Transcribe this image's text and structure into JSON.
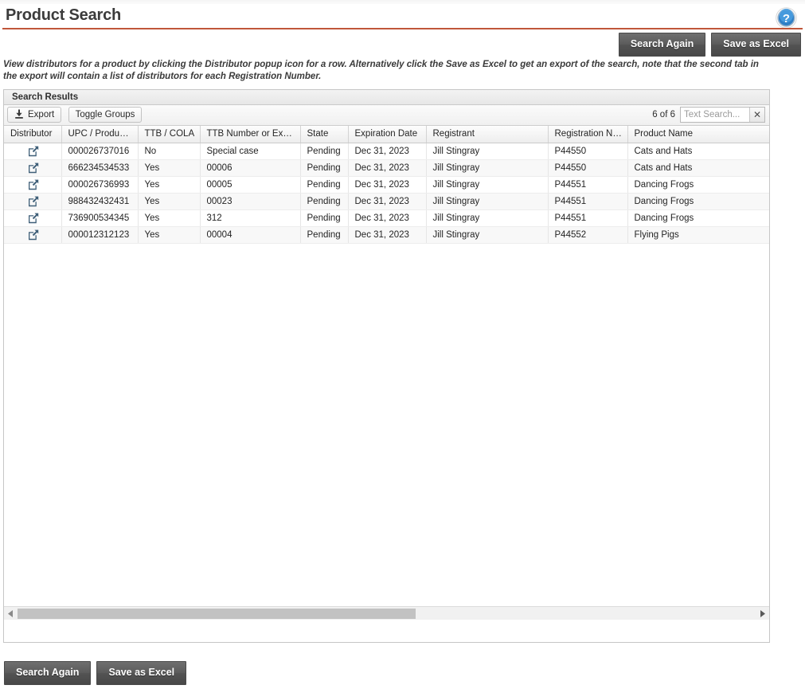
{
  "header": {
    "title": "Product Search",
    "help_icon": "help-circle-icon",
    "accent_color": "#c0563a"
  },
  "top_actions": {
    "search_again_label": "Search Again",
    "save_as_excel_label": "Save as Excel"
  },
  "description": "View distributors for a product by clicking the Distributor popup icon for a row. Alternatively click the Save as Excel to get an export of the search, note that the second tab in the export will contain a list of distributors for each Registration Number.",
  "panel": {
    "header_label": "Search Results"
  },
  "toolbar": {
    "export_label": "Export",
    "export_icon": "download-icon",
    "toggle_groups_label": "Toggle Groups",
    "count_label": "6 of 6",
    "search_placeholder": "Text Search...",
    "search_value": "",
    "clear_icon": "close-icon"
  },
  "grid": {
    "columns": [
      "Distributor",
      "UPC / Product Id",
      "TTB / COLA",
      "TTB Number or Expl...",
      "State",
      "Expiration Date",
      "Registrant",
      "Registration Nu...",
      "Product Name"
    ],
    "row_icon": "external-link-icon",
    "rows": [
      {
        "upc": "000026737016",
        "ttb_cola": "No",
        "ttb_number": "Special case",
        "state": "Pending",
        "expiration": "Dec 31, 2023",
        "registrant": "Jill Stingray",
        "registration": "P44550",
        "product": "Cats and Hats"
      },
      {
        "upc": "666234534533",
        "ttb_cola": "Yes",
        "ttb_number": "00006",
        "state": "Pending",
        "expiration": "Dec 31, 2023",
        "registrant": "Jill Stingray",
        "registration": "P44550",
        "product": "Cats and Hats"
      },
      {
        "upc": "000026736993",
        "ttb_cola": "Yes",
        "ttb_number": "00005",
        "state": "Pending",
        "expiration": "Dec 31, 2023",
        "registrant": "Jill Stingray",
        "registration": "P44551",
        "product": "Dancing Frogs"
      },
      {
        "upc": "988432432431",
        "ttb_cola": "Yes",
        "ttb_number": "00023",
        "state": "Pending",
        "expiration": "Dec 31, 2023",
        "registrant": "Jill Stingray",
        "registration": "P44551",
        "product": "Dancing Frogs"
      },
      {
        "upc": "736900534345",
        "ttb_cola": "Yes",
        "ttb_number": "312",
        "state": "Pending",
        "expiration": "Dec 31, 2023",
        "registrant": "Jill Stingray",
        "registration": "P44551",
        "product": "Dancing Frogs"
      },
      {
        "upc": "000012312123",
        "ttb_cola": "Yes",
        "ttb_number": "00004",
        "state": "Pending",
        "expiration": "Dec 31, 2023",
        "registrant": "Jill Stingray",
        "registration": "P44552",
        "product": "Flying Pigs"
      }
    ]
  },
  "bottom_actions": {
    "search_again_label": "Search Again",
    "save_as_excel_label": "Save as Excel"
  }
}
